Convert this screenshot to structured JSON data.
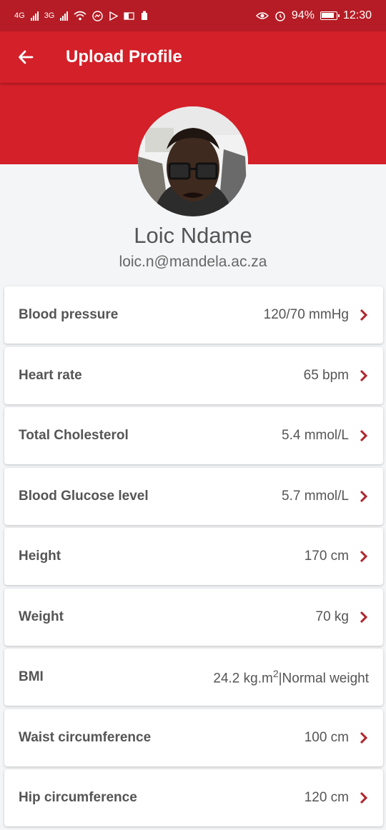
{
  "status_bar": {
    "net1": "4G",
    "net2": "3G",
    "battery": "94%",
    "time": "12:30"
  },
  "app_bar": {
    "title": "Upload Profile"
  },
  "profile": {
    "name": "Loic Ndame",
    "email": "loic.n@mandela.ac.za"
  },
  "metrics": [
    {
      "label": "Blood pressure",
      "value": "120/70 mmHg"
    },
    {
      "label": "Heart rate",
      "value": "65 bpm"
    },
    {
      "label": "Total Cholesterol",
      "value": "5.4 mmol/L"
    },
    {
      "label": "Blood Glucose level",
      "value": "5.7 mmol/L"
    },
    {
      "label": "Height",
      "value": "170 cm"
    },
    {
      "label": "Weight",
      "value": "70 kg"
    },
    {
      "label": "BMI",
      "value_main": "24.2 kg.m",
      "value_sup": "2",
      "value_tail": "|Normal weight"
    },
    {
      "label": "Waist circumference",
      "value": "100 cm"
    },
    {
      "label": "Hip circumference",
      "value": "120 cm"
    }
  ],
  "colors": {
    "primary": "#d42029",
    "status_bar": "#b51c25",
    "chevron": "#b0262e",
    "text": "#555555"
  }
}
